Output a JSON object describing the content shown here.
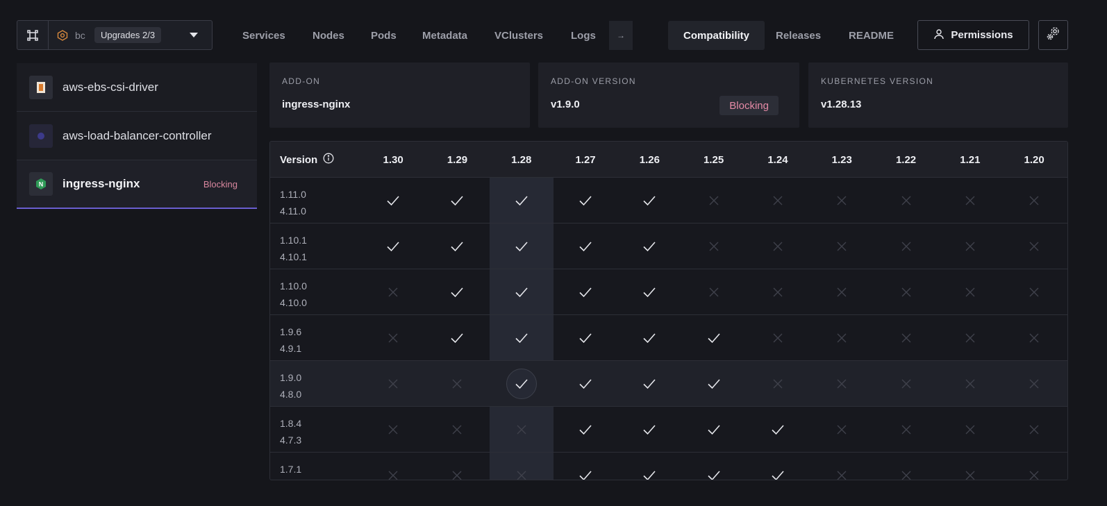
{
  "cluster": {
    "name": "bc",
    "badge": "Upgrades 2/3"
  },
  "nav": {
    "tabs": [
      "Services",
      "Nodes",
      "Pods",
      "Metadata",
      "VClusters",
      "Logs"
    ],
    "arrow": "→",
    "active": "Compatibility",
    "right_tabs": [
      "Releases",
      "README"
    ],
    "permissions": "Permissions"
  },
  "sidebar": {
    "items": [
      {
        "label": "aws-ebs-csi-driver",
        "badge": ""
      },
      {
        "label": "aws-load-balancer-controller",
        "badge": ""
      },
      {
        "label": "ingress-nginx",
        "badge": "Blocking",
        "icon_letter": "N"
      }
    ]
  },
  "cards": {
    "addon": {
      "label": "ADD-ON",
      "value": "ingress-nginx"
    },
    "addon_version": {
      "label": "ADD-ON VERSION",
      "value": "v1.9.0",
      "badge": "Blocking"
    },
    "k8s_version": {
      "label": "KUBERNETES VERSION",
      "value": "v1.28.13"
    }
  },
  "matrix": {
    "header": "Version",
    "columns": [
      "1.30",
      "1.29",
      "1.28",
      "1.27",
      "1.26",
      "1.25",
      "1.24",
      "1.23",
      "1.22",
      "1.21",
      "1.20"
    ],
    "rows": [
      {
        "app": "1.11.0",
        "chart": "4.11.0",
        "support": [
          1,
          1,
          1,
          1,
          1,
          0,
          0,
          0,
          0,
          0,
          0
        ]
      },
      {
        "app": "1.10.1",
        "chart": "4.10.1",
        "support": [
          1,
          1,
          1,
          1,
          1,
          0,
          0,
          0,
          0,
          0,
          0
        ]
      },
      {
        "app": "1.10.0",
        "chart": "4.10.0",
        "support": [
          0,
          1,
          1,
          1,
          1,
          0,
          0,
          0,
          0,
          0,
          0
        ]
      },
      {
        "app": "1.9.6",
        "chart": "4.9.1",
        "support": [
          0,
          1,
          1,
          1,
          1,
          1,
          0,
          0,
          0,
          0,
          0
        ]
      },
      {
        "app": "1.9.0",
        "chart": "4.8.0",
        "support": [
          0,
          0,
          1,
          1,
          1,
          1,
          0,
          0,
          0,
          0,
          0
        ],
        "current": true
      },
      {
        "app": "1.8.4",
        "chart": "4.7.3",
        "support": [
          0,
          0,
          0,
          1,
          1,
          1,
          1,
          0,
          0,
          0,
          0
        ]
      },
      {
        "app": "1.7.1",
        "chart": "",
        "support": [
          0,
          0,
          0,
          1,
          1,
          1,
          1,
          0,
          0,
          0,
          0
        ]
      }
    ]
  },
  "colors": {
    "accent": "#6a5fd0",
    "blocking": "#e58aa6",
    "background": "#15161b"
  }
}
